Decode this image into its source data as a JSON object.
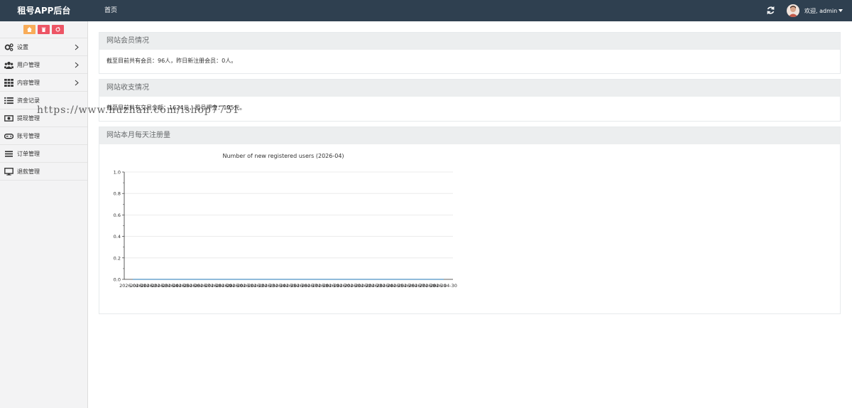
{
  "header": {
    "brand": "租号APP后台",
    "nav_home": "首页",
    "user_greeting": "欢迎, admin",
    "refresh_icon": "refresh-icon",
    "avatar_icon": "user-avatar"
  },
  "sidebar": {
    "quick_buttons": [
      {
        "icon": "home-icon",
        "color": "#f8ac59"
      },
      {
        "icon": "trash-icon",
        "color": "#ed5565"
      },
      {
        "icon": "recycle-icon",
        "color": "#ed5565"
      }
    ],
    "items": [
      {
        "label": "设置",
        "icon": "cogs-icon",
        "has_submenu": true
      },
      {
        "label": "用户管理",
        "icon": "users-icon",
        "has_submenu": true
      },
      {
        "label": "内容管理",
        "icon": "grid-icon",
        "has_submenu": true
      },
      {
        "label": "资金记录",
        "icon": "list-icon",
        "has_submenu": false
      },
      {
        "label": "提现管理",
        "icon": "money-icon",
        "has_submenu": false
      },
      {
        "label": "账号管理",
        "icon": "gamepad-icon",
        "has_submenu": false
      },
      {
        "label": "订单管理",
        "icon": "bars-icon",
        "has_submenu": false
      },
      {
        "label": "退款管理",
        "icon": "desktop-icon",
        "has_submenu": false
      }
    ]
  },
  "panels": {
    "members": {
      "title": "网站会员情况",
      "text": "截至目前共有会员：96人，昨日新注册会员：0人。"
    },
    "finance": {
      "title": "网站收支情况",
      "text": "截至目前共有交易金额：1624元，租号押金：195元。"
    },
    "registrations": {
      "title": "网站本月每天注册量"
    }
  },
  "watermark": "https://www.huzhan.com/ishop7751",
  "chart_data": {
    "type": "line",
    "title": "Number of new registered users (2026-04)",
    "x": [
      "2026-04-01",
      "2026-04-02",
      "2026-04-03",
      "2026-04-04",
      "2026-04-05",
      "2026-04-06",
      "2026-04-07",
      "2026-04-08",
      "2026-04-09",
      "2026-04-10",
      "2026-04-11",
      "2026-04-12",
      "2026-04-13",
      "2026-04-14",
      "2026-04-15",
      "2026-04-16",
      "2026-04-17",
      "2026-04-18",
      "2026-04-19",
      "2026-04-20",
      "2026-04-21",
      "2026-04-22",
      "2026-04-23",
      "2026-04-24",
      "2026-04-25",
      "2026-04-26",
      "2026-04-27",
      "2026-04-28",
      "2026-04-29",
      "2026-04-30"
    ],
    "y_ticks": [
      "0.0",
      "0.2",
      "0.4",
      "0.6",
      "0.8",
      "1.0"
    ],
    "ylim": [
      0,
      1
    ],
    "grid": true,
    "series": [
      {
        "values": [
          0,
          0,
          0,
          0,
          0,
          0,
          0,
          0,
          0,
          0,
          0,
          0,
          0,
          0,
          0,
          0,
          0,
          0,
          0,
          0,
          0,
          0,
          0,
          0,
          0,
          0,
          0,
          0,
          0,
          0
        ]
      }
    ]
  }
}
